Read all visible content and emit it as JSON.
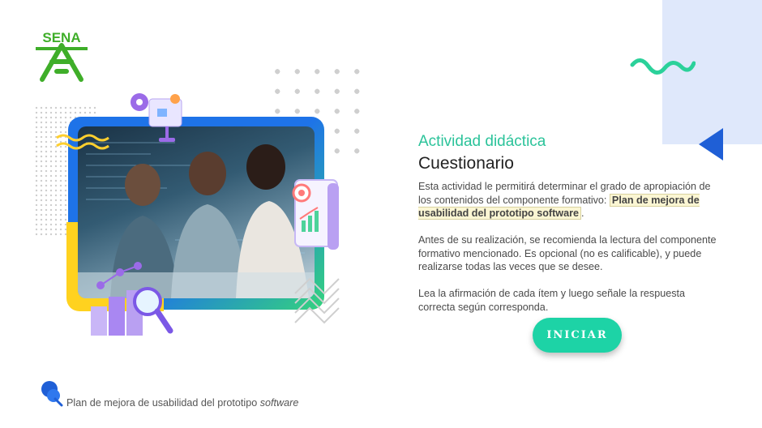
{
  "logo": {
    "text": "SENA"
  },
  "activity": {
    "label": "Actividad didáctica",
    "title": "Cuestionario",
    "para1_before": "Esta actividad le permitirá determinar el grado de apropiación de los contenidos del componente formativo:",
    "para1_highlight": "Plan de mejora de usabilidad del prototipo software",
    "para1_after": ".",
    "para2": "Antes de su realización, se recomienda la lectura del componente formativo mencionado.  Es opcional (no es calificable), y puede realizarse todas las veces que se desee.",
    "para3": "Lea la afirmación de cada ítem y luego señale la respuesta correcta según corresponda."
  },
  "start_button": {
    "label": "INICIAR"
  },
  "footer": {
    "text": "Plan de mejora de usabilidad del prototipo ",
    "italic": "software"
  },
  "icons": {
    "logo": "sena-logo-icon",
    "wave": "wave-icon",
    "triangle": "triangle-left-icon",
    "gear": "gear-icon",
    "puzzle": "puzzle-icon",
    "chart": "chart-icon",
    "target": "target-icon",
    "magnifier": "magnifier-icon",
    "footer": "pushpin-icon"
  },
  "colors": {
    "accent": "#2bc39a",
    "button": "#1dd3a6",
    "blue": "#1f5fd6",
    "panel": "#dfe8fb"
  }
}
